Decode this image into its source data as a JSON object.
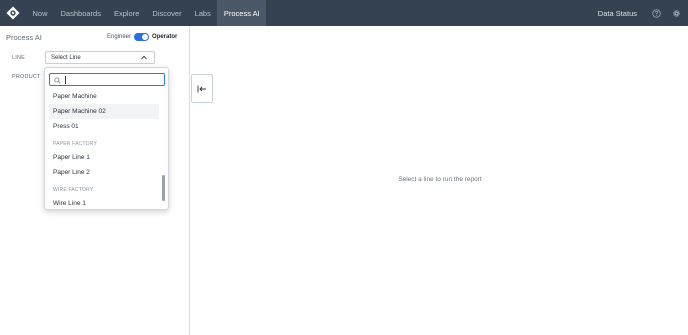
{
  "topbar": {
    "nav": [
      "Now",
      "Dashboards",
      "Explore",
      "Discover",
      "Labs",
      "Process AI"
    ],
    "active_index": 5,
    "data_status": "Data Status",
    "bg_color": "#354251"
  },
  "sidebar": {
    "title": "Process AI",
    "mode_toggle": {
      "left_label": "Engineer",
      "right_label": "Operator",
      "state": "operator"
    },
    "line_label": "LINE",
    "product_label": "PRODUCT",
    "line_select_value": "Select Line"
  },
  "dropdown": {
    "search_placeholder": "",
    "items": [
      {
        "kind": "option",
        "label": "Paper Machine"
      },
      {
        "kind": "option",
        "label": "Paper Machine 02",
        "hover": true
      },
      {
        "kind": "option",
        "label": "Press 01"
      },
      {
        "kind": "group",
        "label": "PAPER FACTORY"
      },
      {
        "kind": "option",
        "label": "Paper Line 1"
      },
      {
        "kind": "option",
        "label": "Paper Line 2"
      },
      {
        "kind": "group",
        "label": "WIRE FACTORY"
      },
      {
        "kind": "option",
        "label": "Wire Line 1"
      }
    ]
  },
  "main": {
    "empty_message": "Select a line to run the report"
  },
  "icons": {
    "logo": "app-logo-icon",
    "help": "help-circle-icon",
    "settings": "gear-icon",
    "collapse": "collapse-left-icon",
    "search": "search-icon",
    "chevron": "chevron-up-icon"
  },
  "colors": {
    "accent": "#2a6fdb",
    "focus": "#2a7be4"
  }
}
